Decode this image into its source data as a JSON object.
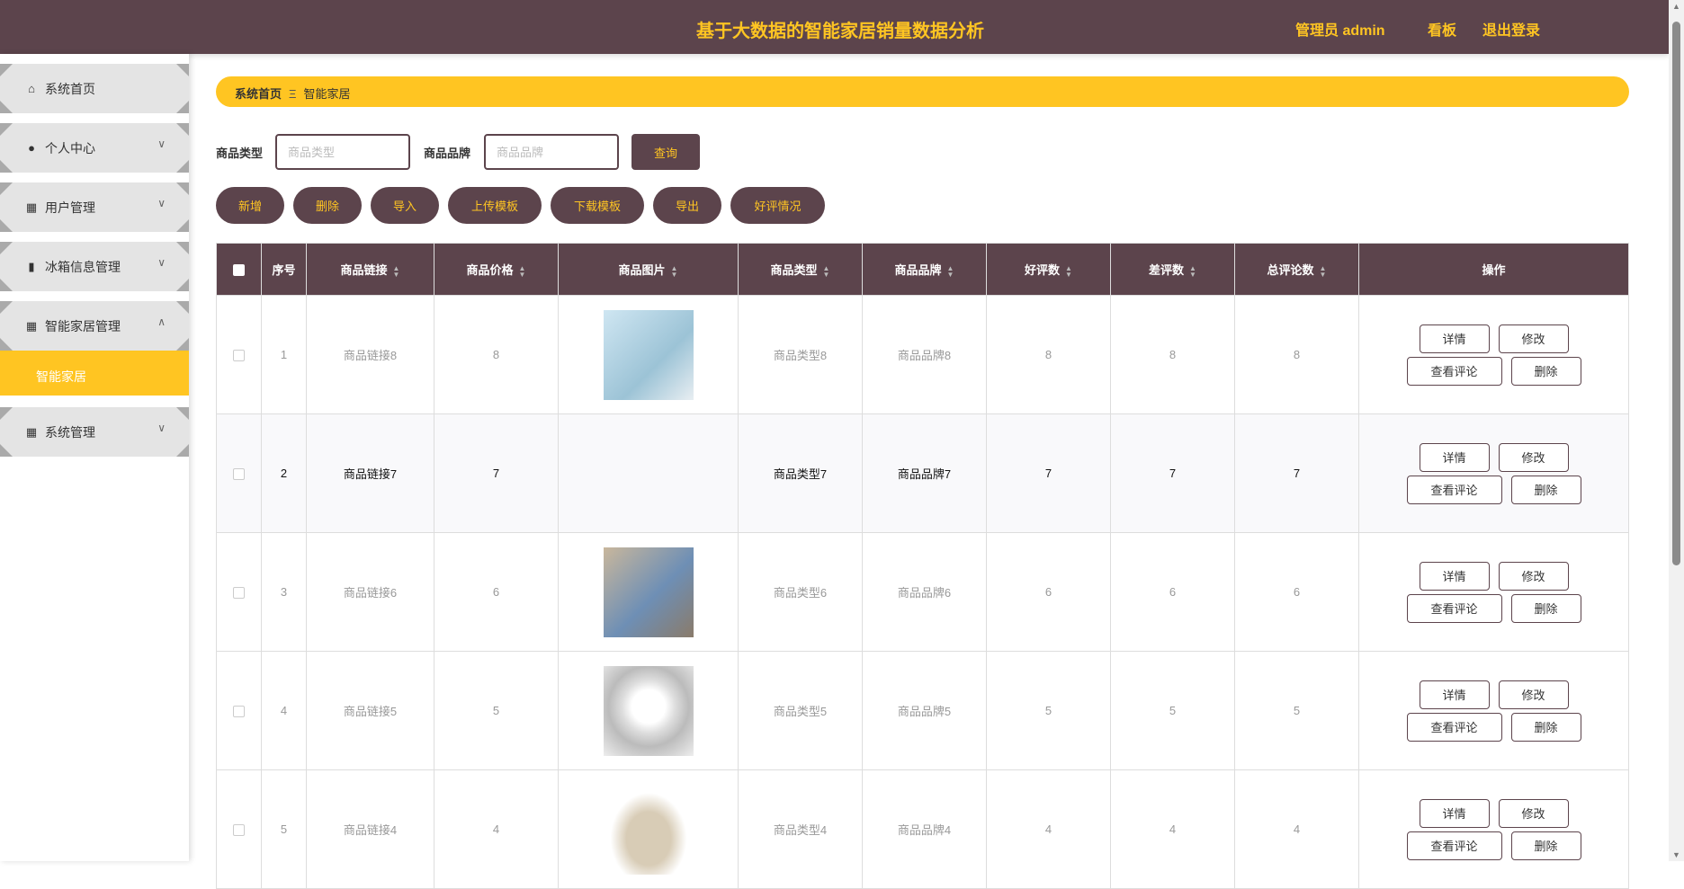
{
  "header": {
    "title": "基于大数据的智能家居销量数据分析",
    "user": "管理员 admin",
    "dashboard": "看板",
    "logout": "退出登录"
  },
  "sidebar": {
    "items": [
      {
        "label": "系统首页",
        "icon": "home-icon"
      },
      {
        "label": "个人中心",
        "icon": "user-icon"
      },
      {
        "label": "用户管理",
        "icon": "grid-icon"
      },
      {
        "label": "冰箱信息管理",
        "icon": "book-icon"
      },
      {
        "label": "智能家居管理",
        "icon": "grid-icon"
      },
      {
        "label": "系统管理",
        "icon": "grid-icon"
      }
    ],
    "sub_item": "智能家居"
  },
  "breadcrumb": {
    "home": "系统首页",
    "separator": "Ξ",
    "current": "智能家居"
  },
  "search": {
    "type_label": "商品类型",
    "type_placeholder": "商品类型",
    "brand_label": "商品品牌",
    "brand_placeholder": "商品品牌",
    "query": "查询"
  },
  "actions": [
    "新增",
    "删除",
    "导入",
    "上传模板",
    "下载模板",
    "导出",
    "好评情况"
  ],
  "table": {
    "columns": [
      "序号",
      "商品链接",
      "商品价格",
      "商品图片",
      "商品类型",
      "商品品牌",
      "好评数",
      "差评数",
      "总评论数",
      "操作"
    ],
    "row_buttons": {
      "detail": "详情",
      "edit": "修改",
      "comments": "查看评论",
      "delete": "删除"
    },
    "rows": [
      {
        "index": "1",
        "link": "商品链接8",
        "price": "8",
        "type": "商品类型8",
        "brand": "商品品牌8",
        "good": "8",
        "bad": "8",
        "total": "8"
      },
      {
        "index": "2",
        "link": "商品链接7",
        "price": "7",
        "type": "商品类型7",
        "brand": "商品品牌7",
        "good": "7",
        "bad": "7",
        "total": "7"
      },
      {
        "index": "3",
        "link": "商品链接6",
        "price": "6",
        "type": "商品类型6",
        "brand": "商品品牌6",
        "good": "6",
        "bad": "6",
        "total": "6"
      },
      {
        "index": "4",
        "link": "商品链接5",
        "price": "5",
        "type": "商品类型5",
        "brand": "商品品牌5",
        "good": "5",
        "bad": "5",
        "total": "5"
      },
      {
        "index": "5",
        "link": "商品链接4",
        "price": "4",
        "type": "商品类型4",
        "brand": "商品品牌4",
        "good": "4",
        "bad": "4",
        "total": "4"
      }
    ]
  },
  "colors": {
    "primary": "#5c444c",
    "accent": "#ffc522"
  }
}
